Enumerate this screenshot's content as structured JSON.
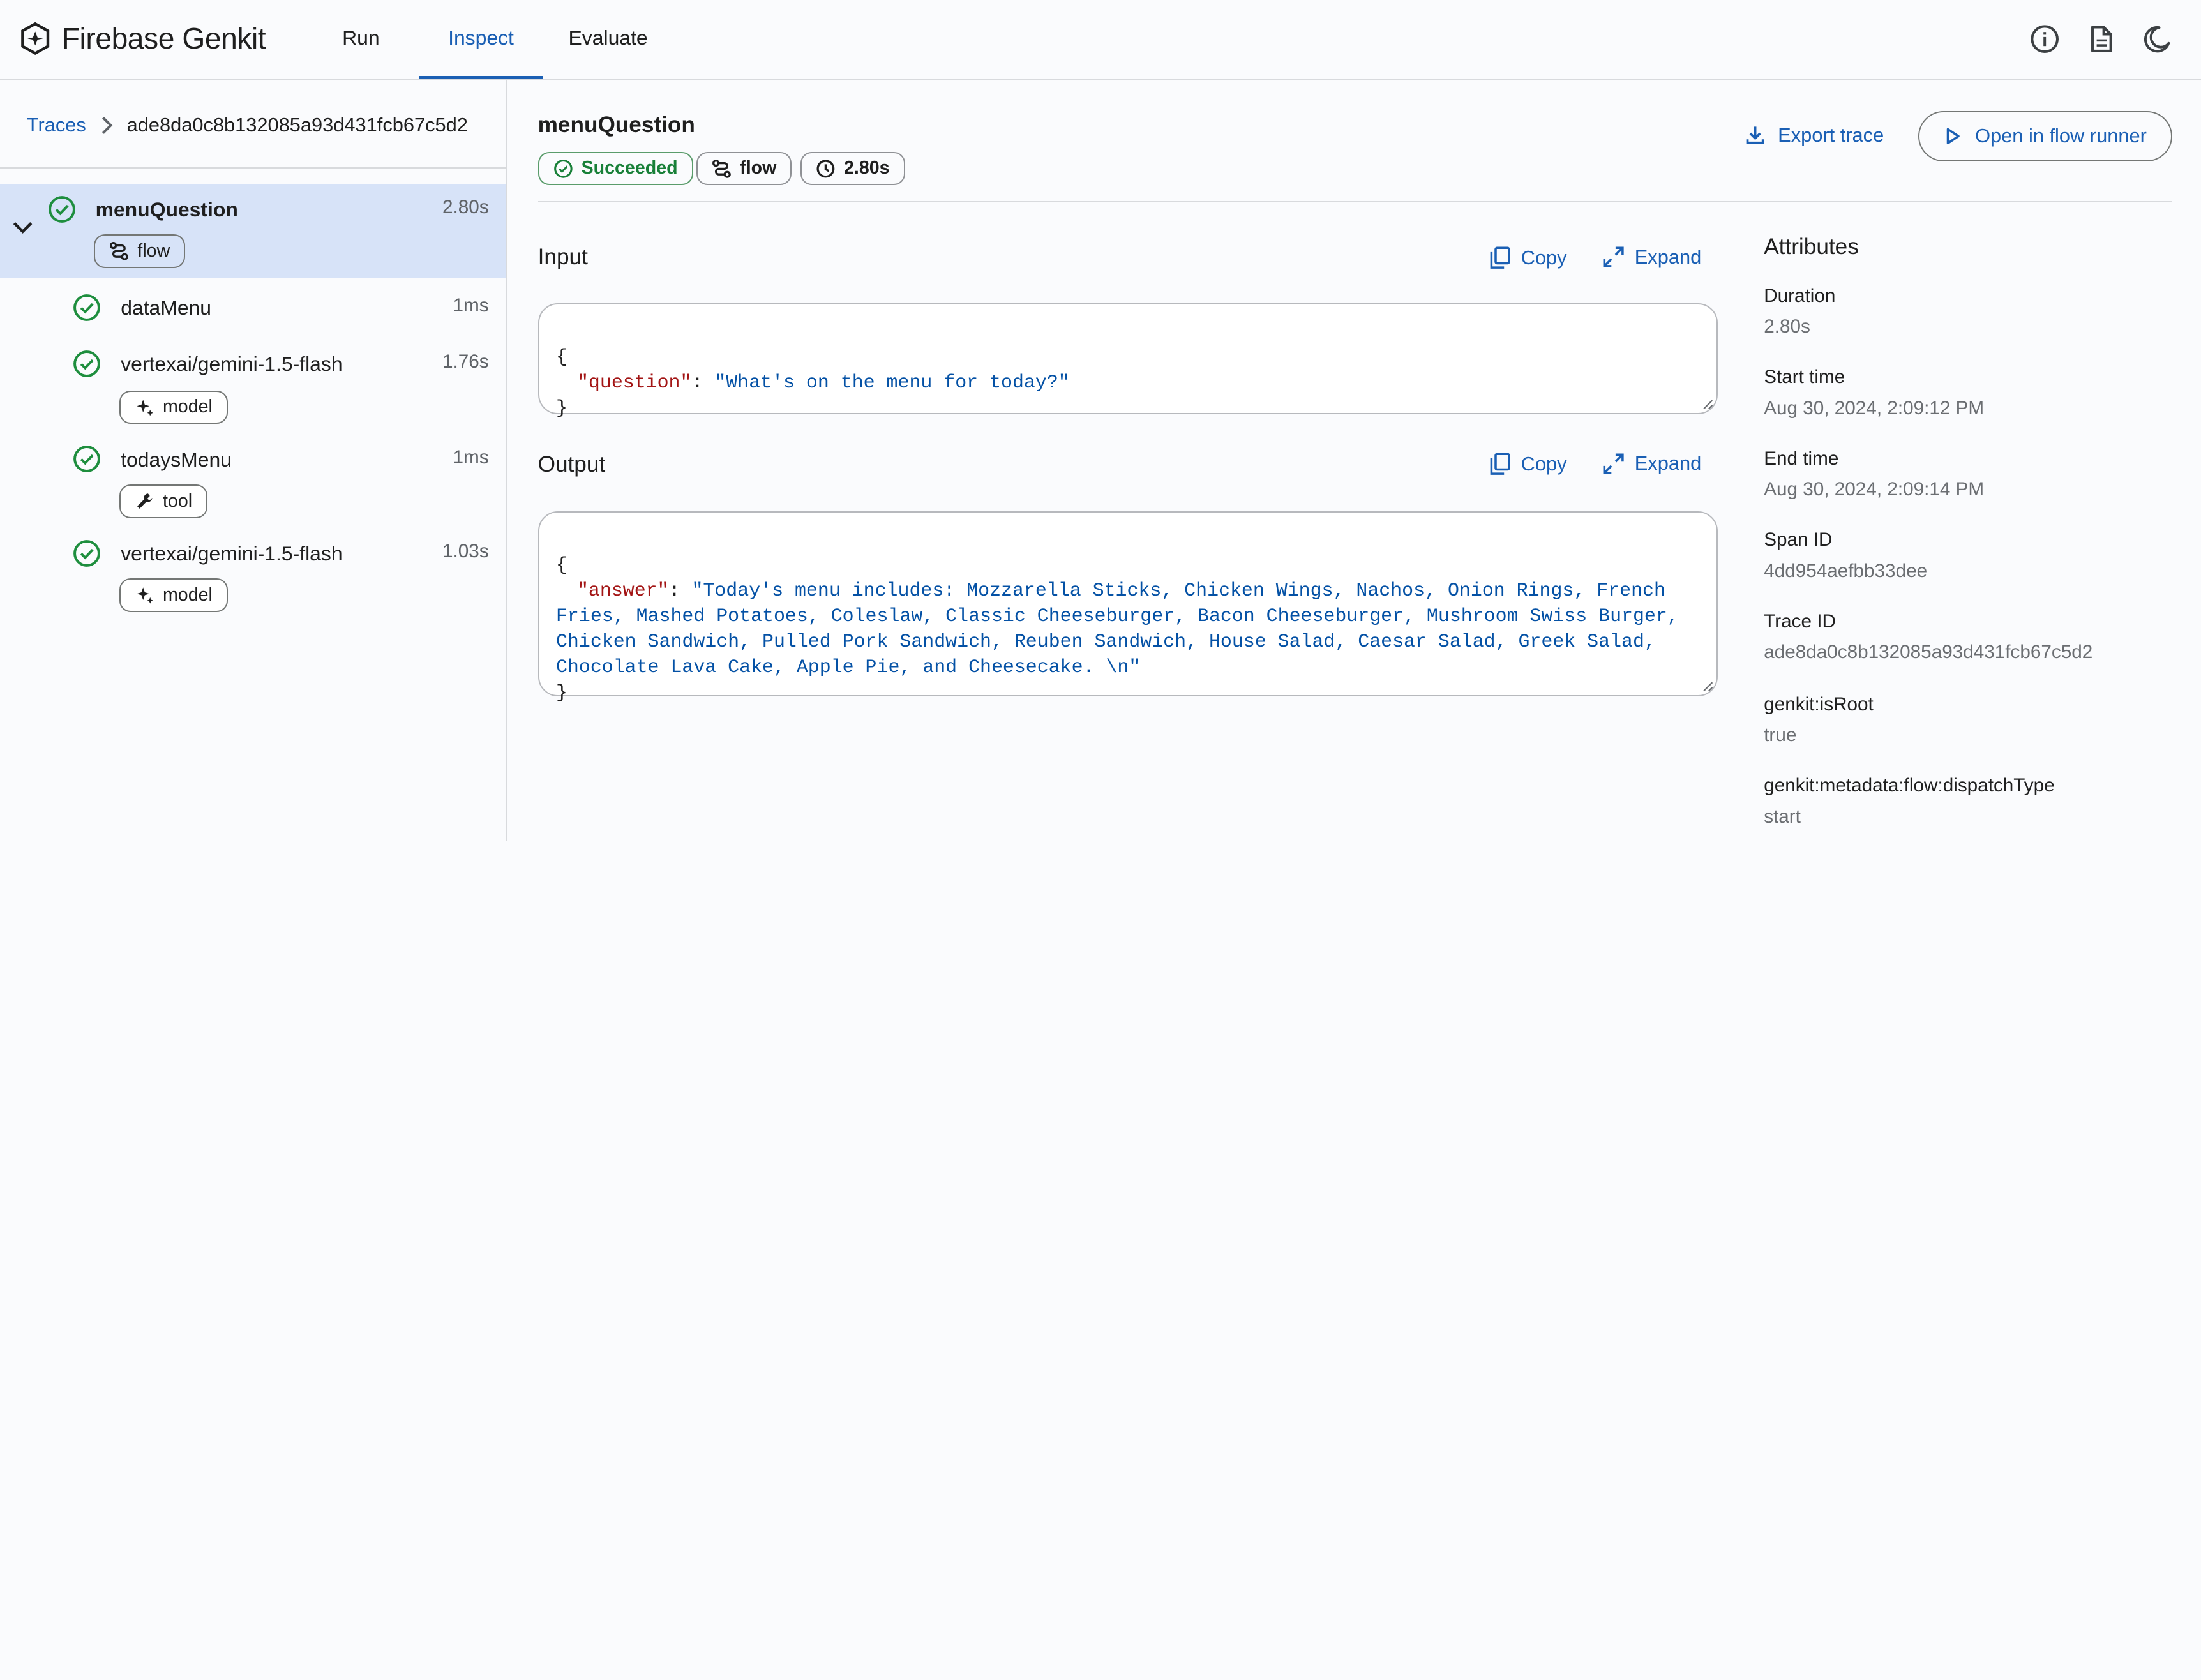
{
  "app": {
    "title": "Firebase Genkit"
  },
  "nav": {
    "tabs": [
      {
        "label": "Run"
      },
      {
        "label": "Inspect"
      },
      {
        "label": "Evaluate"
      }
    ],
    "active": "Inspect"
  },
  "top_icons": [
    "info-icon",
    "docs-icon",
    "dark-mode-icon"
  ],
  "breadcrumb": {
    "root": "Traces",
    "trace_id": "ade8da0c8b132085a93d431fcb67c5d2"
  },
  "spans": [
    {
      "name": "menuQuestion",
      "duration": "2.80s",
      "chip": "flow",
      "selected": true
    },
    {
      "name": "dataMenu",
      "duration": "1ms"
    },
    {
      "name": "vertexai/gemini-1.5-flash",
      "duration": "1.76s",
      "chip": "model"
    },
    {
      "name": "todaysMenu",
      "duration": "1ms",
      "chip": "tool"
    },
    {
      "name": "vertexai/gemini-1.5-flash",
      "duration": "1.03s",
      "chip": "model"
    }
  ],
  "detail": {
    "title": "menuQuestion",
    "badges": {
      "status": "Succeeded",
      "type": "flow",
      "duration": "2.80s"
    },
    "export_label": "Export trace",
    "runner_label": "Open in flow runner"
  },
  "input": {
    "label": "Input",
    "copy_label": "Copy",
    "expand_label": "Expand",
    "open": "{",
    "key": "\"question\"",
    "sep": ": ",
    "value": "\"What's on the menu for today?\"",
    "close": "}"
  },
  "output": {
    "label": "Output",
    "copy_label": "Copy",
    "expand_label": "Expand",
    "open": "{",
    "key": "\"answer\"",
    "sep": ": ",
    "value": "\"Today's menu includes: Mozzarella Sticks, Chicken Wings, Nachos, Onion Rings, French Fries, Mashed Potatoes, Coleslaw, Classic Cheeseburger, Bacon Cheeseburger, Mushroom Swiss Burger, Chicken Sandwich, Pulled Pork Sandwich, Reuben Sandwich, House Salad, Caesar Salad, Greek Salad, Chocolate Lava Cake, Apple Pie, and Cheesecake. \\n\"",
    "close": "}"
  },
  "attributes": {
    "title": "Attributes",
    "items": [
      {
        "name": "Duration",
        "value": "2.80s"
      },
      {
        "name": "Start time",
        "value": "Aug 30, 2024, 2:09:12 PM"
      },
      {
        "name": "End time",
        "value": "Aug 30, 2024, 2:09:14 PM"
      },
      {
        "name": "Span ID",
        "value": "4dd954aefbb33dee"
      },
      {
        "name": "Trace ID",
        "value": "ade8da0c8b132085a93d431fcb67c5d2"
      },
      {
        "name": "genkit:isRoot",
        "value": "true"
      },
      {
        "name": "genkit:metadata:flow:dispatchType",
        "value": "start"
      }
    ]
  },
  "colors": {
    "accent": "#1a5fb4",
    "success": "#188038",
    "selected_row": "#d7e3f8",
    "json_key": "#a31515",
    "json_string": "#0451a5"
  }
}
